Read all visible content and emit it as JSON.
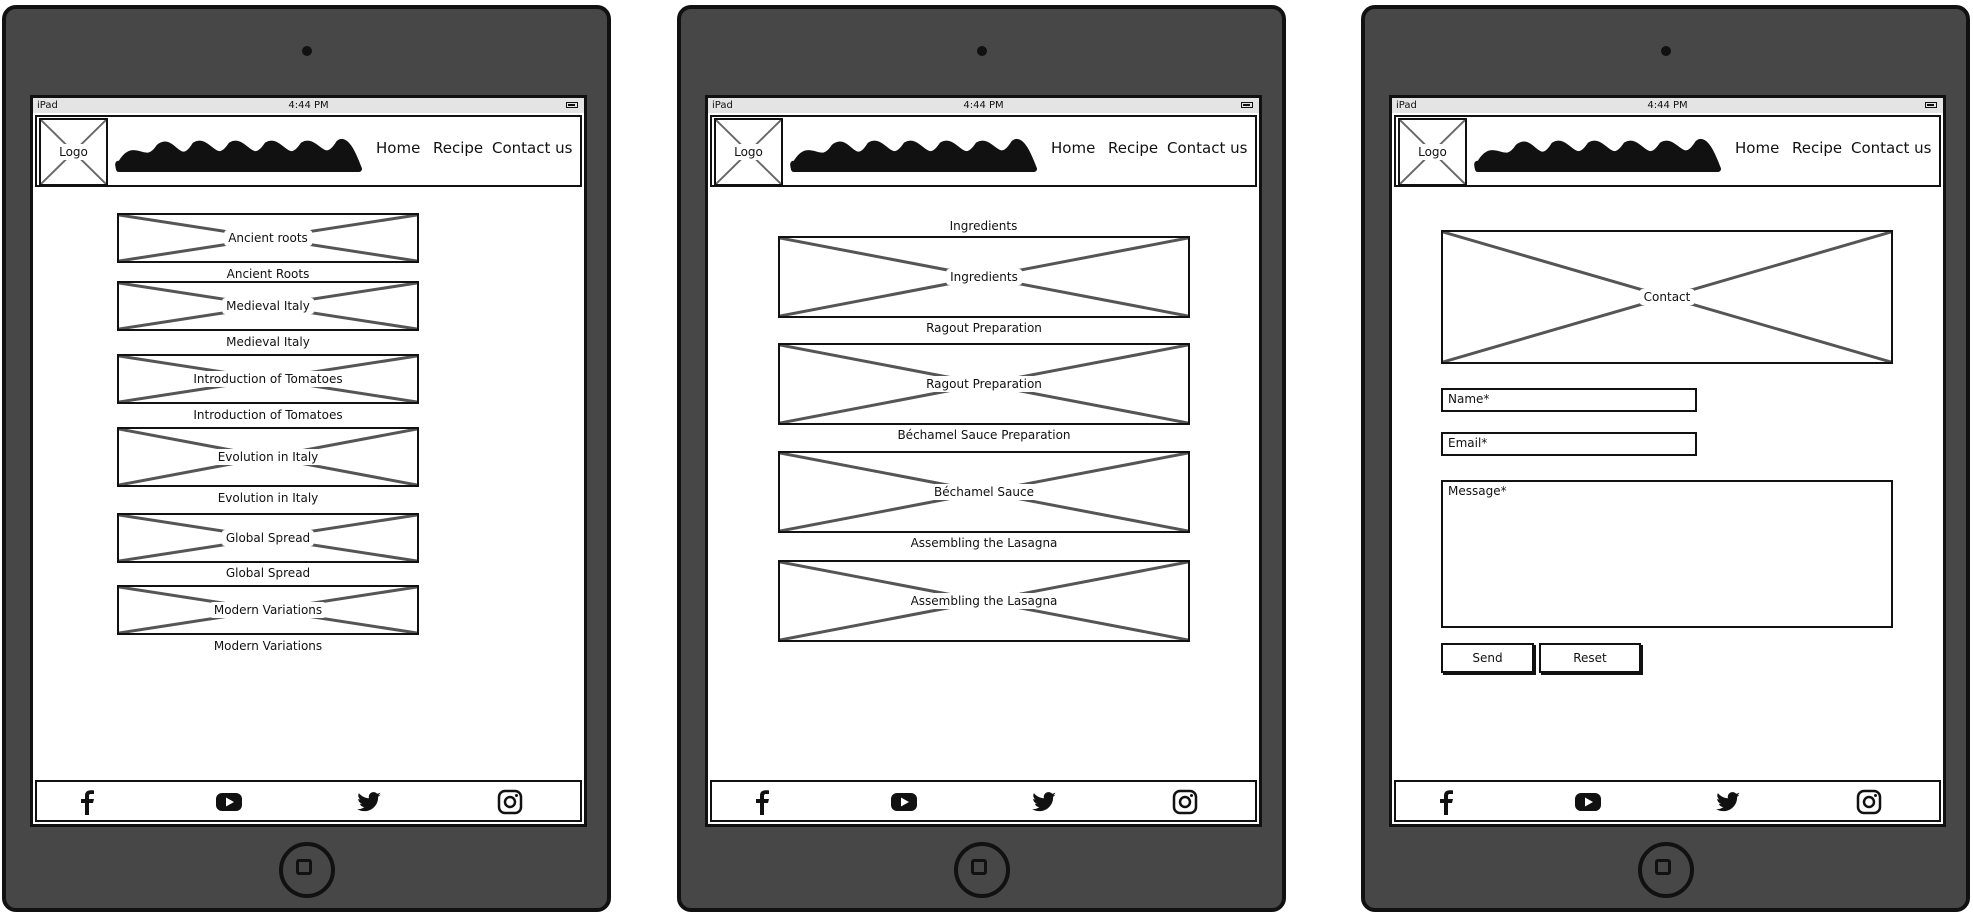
{
  "devices": [
    {
      "status": {
        "carrier": "iPad",
        "time": "4:44 PM"
      },
      "logo": "Logo",
      "nav": [
        "Home",
        "Recipe",
        "Contact us"
      ],
      "items": [
        {
          "image_label": "Ancient roots",
          "caption": "Ancient Roots"
        },
        {
          "image_label": "Medieval Italy",
          "caption": "Medieval Italy"
        },
        {
          "image_label": "Introduction of Tomatoes",
          "caption": "Introduction of Tomatoes"
        },
        {
          "image_label": "Evolution in Italy",
          "caption": "Evolution in Italy"
        },
        {
          "image_label": "Global Spread",
          "caption": "Global Spread"
        },
        {
          "image_label": "Modern Variations",
          "caption": "Modern Variations"
        }
      ]
    },
    {
      "status": {
        "carrier": "iPad",
        "time": "4:44 PM"
      },
      "logo": "Logo",
      "nav": [
        "Home",
        "Recipe",
        "Contact us"
      ],
      "section_title": "Ingredients",
      "items": [
        {
          "image_label": "Ingredients",
          "caption": "Ragout Preparation"
        },
        {
          "image_label": "Ragout Preparation",
          "caption": "Béchamel Sauce Preparation"
        },
        {
          "image_label": "Béchamel Sauce",
          "caption": "Assembling the Lasagna"
        },
        {
          "image_label": "Assembling the Lasagna",
          "caption": ""
        }
      ]
    },
    {
      "status": {
        "carrier": "iPad",
        "time": "4:44 PM"
      },
      "logo": "Logo",
      "nav": [
        "Home",
        "Recipe",
        "Contact us"
      ],
      "contact_image": "Contact",
      "form": {
        "name_placeholder": "Name*",
        "email_placeholder": "Email*",
        "message_placeholder": "Message*",
        "send_label": "Send",
        "reset_label": "Reset"
      }
    }
  ],
  "footer_icons": [
    "facebook-icon",
    "youtube-icon",
    "twitter-icon",
    "instagram-icon"
  ]
}
